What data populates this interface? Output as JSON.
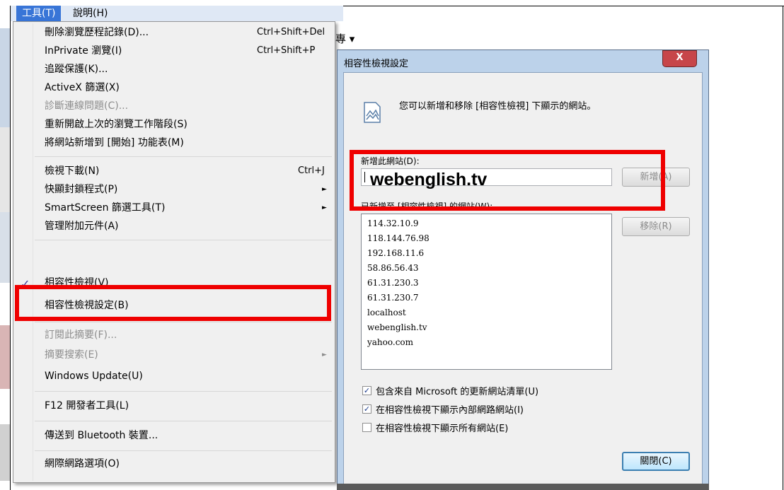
{
  "menubar": {
    "tools": "工具(T)",
    "help": "說明(H)"
  },
  "menu": {
    "items": [
      {
        "label": "刪除瀏覽歷程記錄(D)...",
        "shortcut": "Ctrl+Shift+Del"
      },
      {
        "label": "InPrivate 瀏覽(I)",
        "shortcut": "Ctrl+Shift+P"
      },
      {
        "label": "追蹤保護(K)..."
      },
      {
        "label": "ActiveX 篩選(X)"
      },
      {
        "label": "診斷連線問題(C)..."
      },
      {
        "label": "重新開啟上次的瀏覽工作階段(S)"
      },
      {
        "label": "將網站新增到 [開始] 功能表(M)"
      },
      {
        "label": "檢視下載(N)",
        "shortcut": "Ctrl+J"
      },
      {
        "label": "快顯封鎖程式(P)"
      },
      {
        "label": "SmartScreen 篩選工具(T)"
      },
      {
        "label": "管理附加元件(A)"
      },
      {
        "label": "相容性檢視(V)"
      },
      {
        "label": "相容性檢視設定(B)"
      },
      {
        "label": "訂閱此摘要(F)..."
      },
      {
        "label": "摘要搜索(E)"
      },
      {
        "label": "Windows Update(U)"
      },
      {
        "label": "F12 開發者工具(L)"
      },
      {
        "label": "傳送到 Bluetooth 裝置..."
      },
      {
        "label": "網際網路選項(O)"
      }
    ],
    "check_mark": "✓",
    "submenu_arrow": "►"
  },
  "dialog": {
    "title": "相容性檢視設定",
    "close_label": "X",
    "info_text": "您可以新增和移除 [相容性檢視] 下顯示的網站。",
    "add_label": "新增此網站(D):",
    "input_value": "",
    "overlay_url": "webenglish.tv",
    "add_button": "新增(A)",
    "list_label": "已新增至 [相容性檢視] 的網站(W):",
    "remove_button": "移除(R)",
    "sites": [
      "114.32.10.9",
      "118.144.76.98",
      "192.168.11.6",
      "58.86.56.43",
      "61.31.230.3",
      "61.31.230.7",
      "localhost",
      "webenglish.tv",
      "yahoo.com"
    ],
    "options": [
      {
        "label": "包含來自 Microsoft 的更新網站清單(U)",
        "checked": true
      },
      {
        "label": "在相容性檢視下顯示內部網路網站(I)",
        "checked": true
      },
      {
        "label": "在相容性檢視下顯示所有網站(E)",
        "checked": false
      }
    ],
    "close_button": "關閉(C)"
  },
  "colors": {
    "highlight": "#ef0000",
    "menu_bg": "#f0f0f0",
    "dialog_frame": "#bcd2ea"
  },
  "background_fragment": "專 ▾"
}
